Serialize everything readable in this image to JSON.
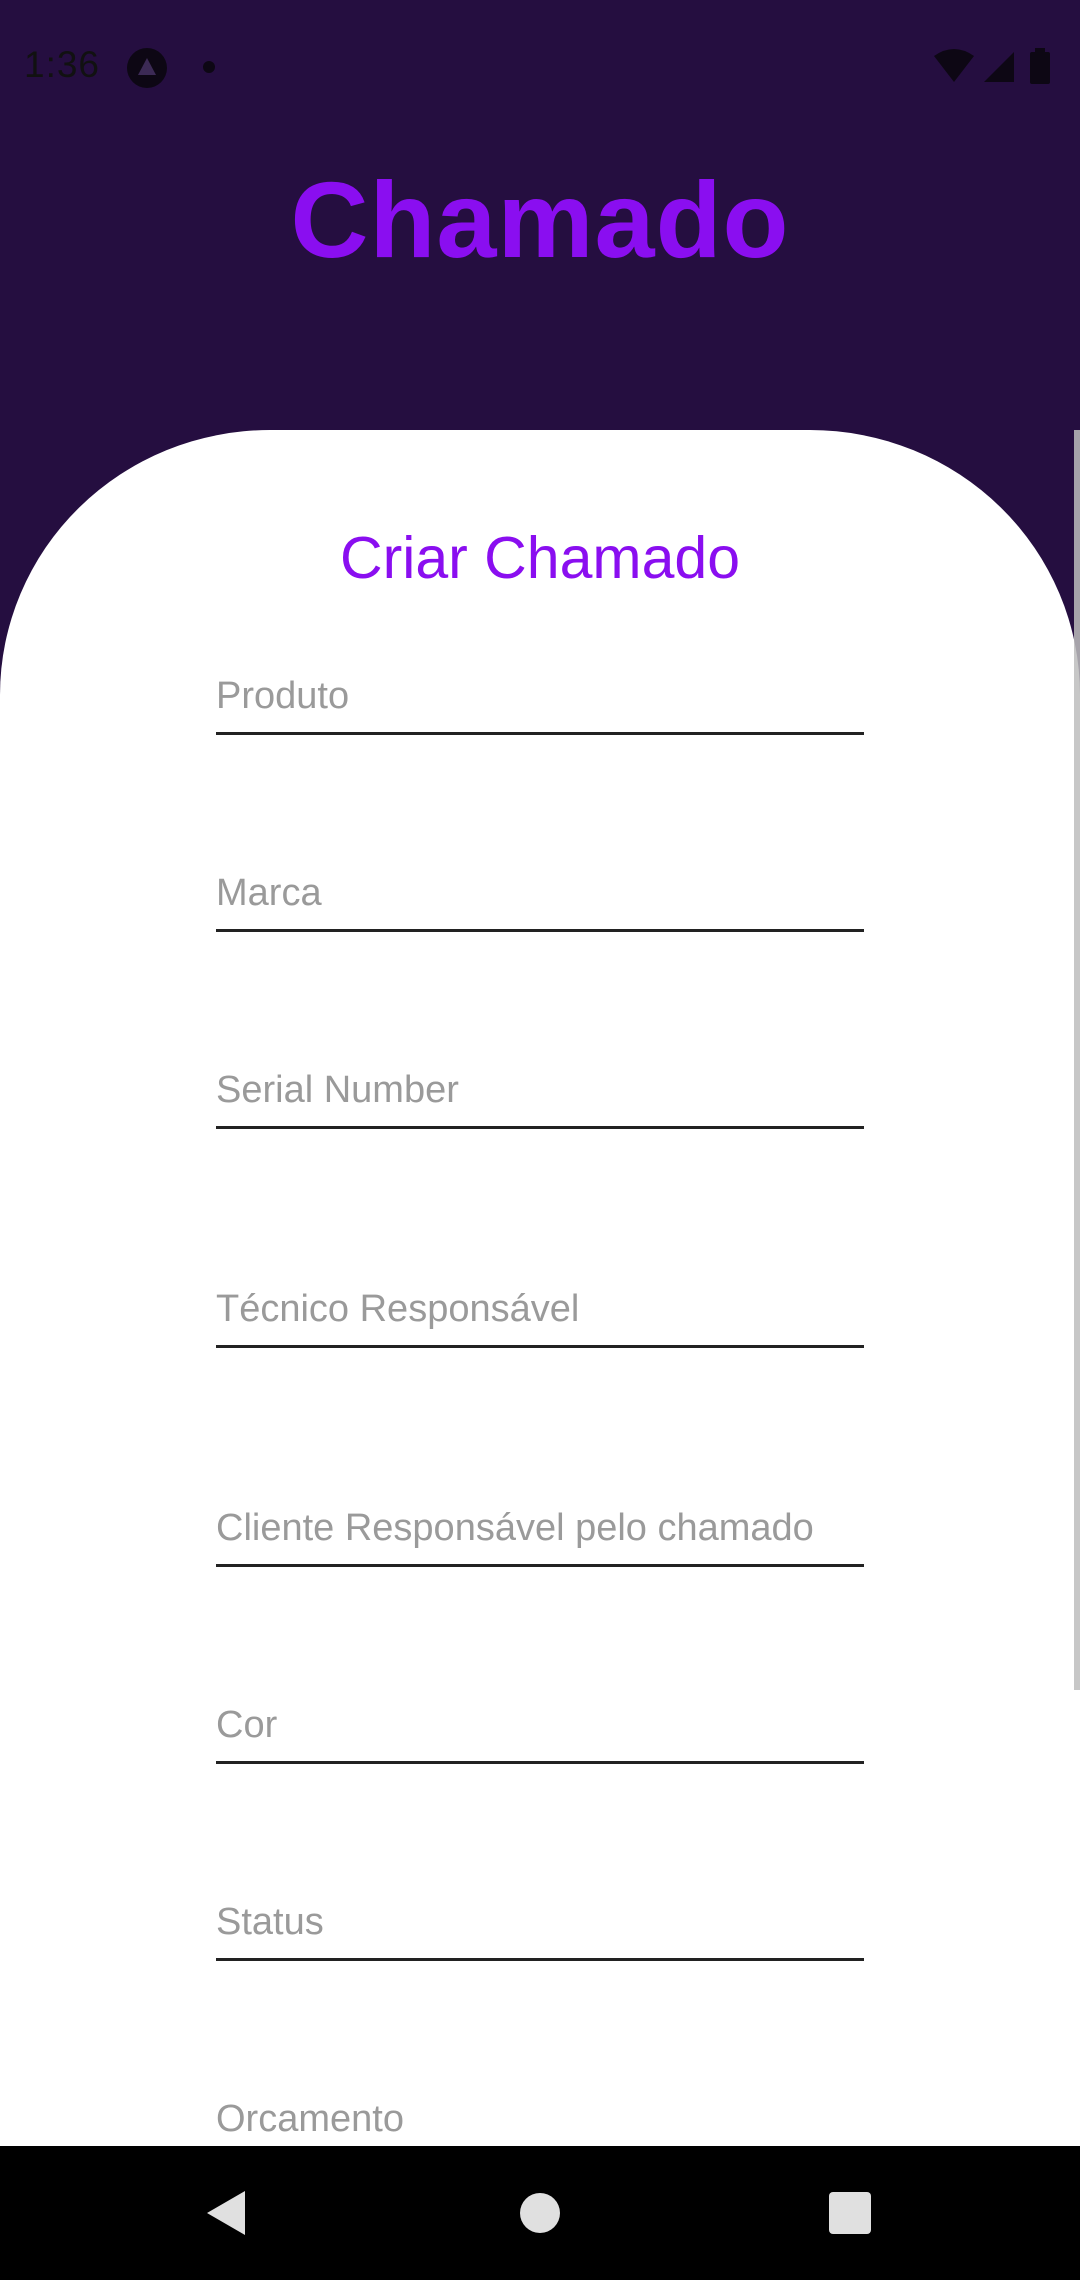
{
  "status_bar": {
    "time": "1:36",
    "icons": [
      "app-notification-icon",
      "dot-icon",
      "wifi-icon",
      "signal-icon",
      "battery-icon"
    ]
  },
  "header": {
    "title": "Chamado"
  },
  "form": {
    "title": "Criar Chamado",
    "fields": [
      {
        "placeholder": "Produto",
        "value": ""
      },
      {
        "placeholder": "Marca",
        "value": ""
      },
      {
        "placeholder": "Serial Number",
        "value": ""
      },
      {
        "placeholder": "Técnico Responsável",
        "value": ""
      },
      {
        "placeholder": "Cliente Responsável pelo chamado",
        "value": ""
      },
      {
        "placeholder": "Cor",
        "value": ""
      },
      {
        "placeholder": "Status",
        "value": ""
      },
      {
        "placeholder": "Orcamento",
        "value": ""
      }
    ]
  },
  "nav_bar": {
    "icons": [
      "back-icon",
      "home-icon",
      "recents-icon"
    ]
  },
  "colors": {
    "background": "#250e40",
    "accent": "#8a0ef0",
    "card": "#ffffff",
    "placeholder": "#9a9a9a"
  }
}
